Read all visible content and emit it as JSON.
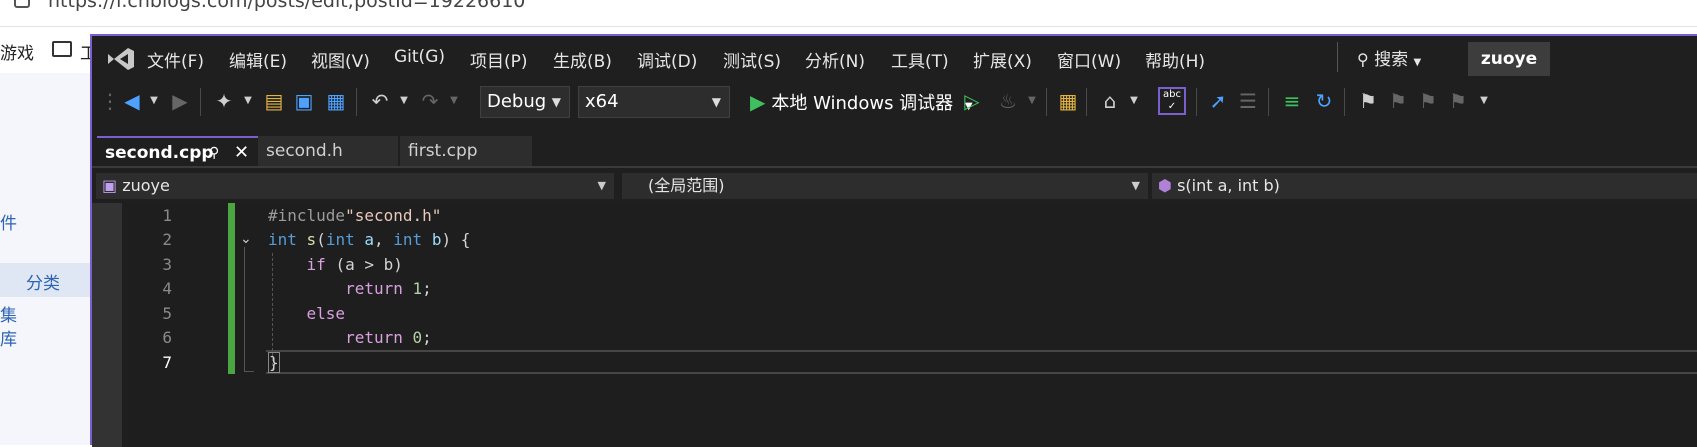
{
  "browser": {
    "url": "https://i.cnblogs.com/posts/edit;postId=19226610",
    "bookmark_left": "游戏",
    "bookmark_folder": "工"
  },
  "blog_sidebar": {
    "item1": "件",
    "category": "分类",
    "item3": "集",
    "item4": "库"
  },
  "menu": {
    "items": [
      "文件(F)",
      "编辑(E)",
      "视图(V)",
      "Git(G)",
      "项目(P)",
      "生成(B)",
      "调试(D)",
      "测试(S)",
      "分析(N)",
      "工具(T)",
      "扩展(X)",
      "窗口(W)",
      "帮助(H)"
    ],
    "search_label": "搜索",
    "user": "zuoye"
  },
  "toolbar": {
    "config": "Debug",
    "platform": "x64",
    "run_label": "本地 Windows 调试器"
  },
  "tabs": {
    "active": "second.cpp",
    "tab2": "second.h",
    "tab3": "first.cpp"
  },
  "navbar": {
    "project": "zuoye",
    "scope": "(全局范围)",
    "member": "s(int a, int b)"
  },
  "editor": {
    "line_numbers": [
      "1",
      "2",
      "3",
      "4",
      "5",
      "6",
      "7"
    ],
    "include_directive": "#include",
    "include_file": "\"second.h\"",
    "kw_int": "int",
    "fn_name": "s",
    "param_a": "a",
    "param_b": "b",
    "kw_if": "if",
    "cond": "(a > b)",
    "kw_return": "return",
    "ret1": "1",
    "kw_else": "else",
    "ret0": "0",
    "close_brace": "}"
  }
}
